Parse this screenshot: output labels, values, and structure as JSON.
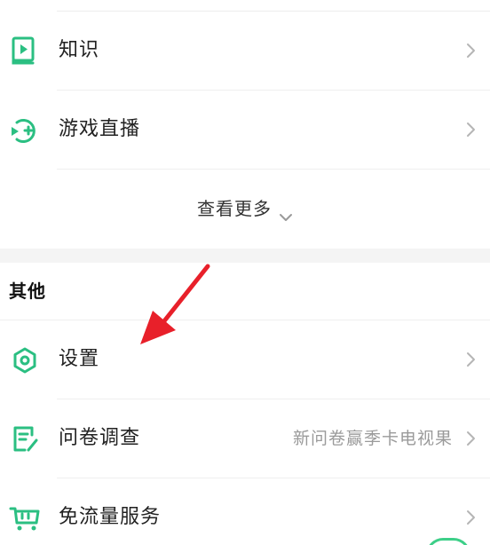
{
  "colors": {
    "accent": "#2bbf82",
    "text_primary": "#222222",
    "text_secondary": "#9a9a9a",
    "section_gap": "#f4f4f4",
    "annotation_arrow": "#e8202a"
  },
  "service_list": {
    "items": [
      {
        "label": "知识",
        "icon": "video-book-icon"
      },
      {
        "label": "游戏直播",
        "icon": "game-live-icon"
      }
    ],
    "more_label": "查看更多",
    "more_icon": "chevron-down-icon"
  },
  "other_section": {
    "title": "其他",
    "items": [
      {
        "label": "设置",
        "icon": "hexagon-settings-icon",
        "hint": ""
      },
      {
        "label": "问卷调查",
        "icon": "survey-edit-icon",
        "hint": "新问卷赢季卡电视果"
      },
      {
        "label": "免流量服务",
        "icon": "tv-cart-icon",
        "hint": ""
      }
    ]
  },
  "annotation": {
    "icon": "red-arrow-pointer",
    "target": "设置"
  }
}
